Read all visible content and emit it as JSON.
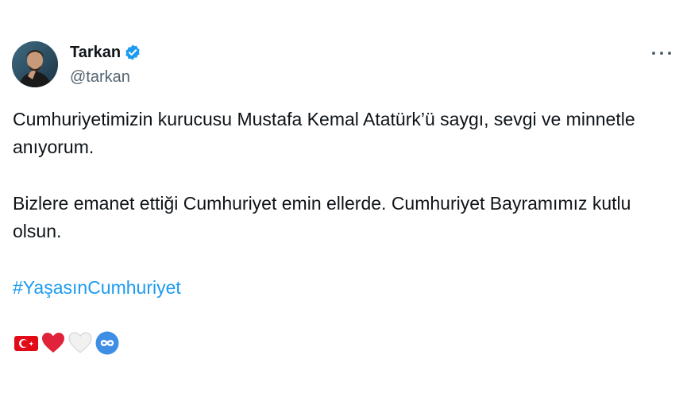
{
  "author": {
    "display_name": "Tarkan",
    "handle": "@tarkan",
    "verified": true,
    "avatar_icon": "user-avatar-photo"
  },
  "menu": {
    "icon": "more-horizontal-icon"
  },
  "tweet": {
    "paragraph1": "Cumhuriyetimizin kurucusu Mustafa Kemal Atatürk’ü saygı, sevgi ve minnetle anıyorum.",
    "paragraph2": "Bizlere emanet ettiği Cumhuriyet emin ellerde. Cumhuriyet Bayramımız kutlu olsun.",
    "hashtag": "#YaşasınCumhuriyet",
    "emojis": [
      "turkey-flag-icon",
      "red-heart-icon",
      "white-heart-icon",
      "infinity-icon"
    ]
  },
  "colors": {
    "link": "#1d9bf0",
    "verified": "#1d9bf0",
    "text": "#0f1419",
    "muted": "#536471",
    "flag_red": "#e30a17",
    "heart_red": "#e0223a"
  }
}
